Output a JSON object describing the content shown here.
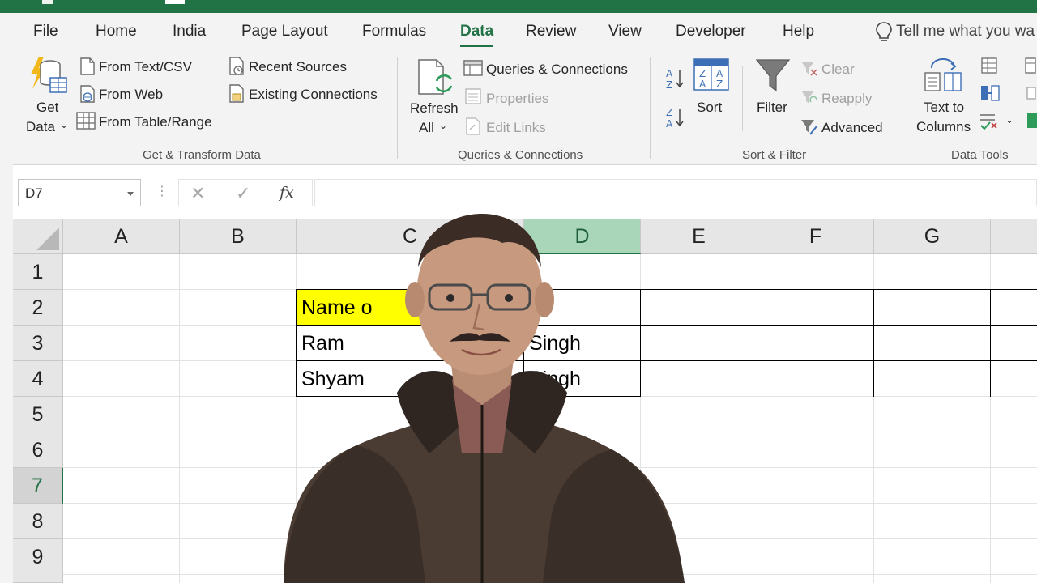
{
  "app": {
    "accent": "#217346"
  },
  "menu": {
    "tabs": [
      {
        "label": "File"
      },
      {
        "label": "Home"
      },
      {
        "label": "India"
      },
      {
        "label": "Page Layout"
      },
      {
        "label": "Formulas"
      },
      {
        "label": "Data",
        "active": true
      },
      {
        "label": "Review"
      },
      {
        "label": "View"
      },
      {
        "label": "Developer"
      },
      {
        "label": "Help"
      }
    ],
    "tell_me": "Tell me what you wa"
  },
  "ribbon": {
    "get_transform": {
      "get_data_line1": "Get",
      "get_data_line2": "Data",
      "from_text_csv": "From Text/CSV",
      "from_web": "From Web",
      "from_table_range": "From Table/Range",
      "recent_sources": "Recent Sources",
      "existing_connections": "Existing Connections",
      "label": "Get & Transform Data"
    },
    "queries": {
      "refresh_line1": "Refresh",
      "refresh_line2": "All",
      "queries_connections": "Queries & Connections",
      "properties": "Properties",
      "edit_links": "Edit Links",
      "label": "Queries & Connections"
    },
    "sort_filter": {
      "sort": "Sort",
      "filter": "Filter",
      "clear": "Clear",
      "reapply": "Reapply",
      "advanced": "Advanced",
      "label": "Sort & Filter"
    },
    "data_tools": {
      "text_to_columns_line1": "Text to",
      "text_to_columns_line2": "Columns",
      "label": "Data Tools"
    }
  },
  "formula_bar": {
    "name_box": "D7",
    "fx": "fx",
    "cancel": "✕",
    "enter": "✓",
    "content": ""
  },
  "sheet": {
    "columns": [
      "A",
      "B",
      "C",
      "D",
      "E",
      "F",
      "G"
    ],
    "rows": [
      "1",
      "2",
      "3",
      "4",
      "5",
      "6",
      "7",
      "8",
      "9"
    ],
    "selected_column": "D",
    "selected_row": "7",
    "cells": {
      "C2": "Name o",
      "C3": "Ram",
      "C4": "Shyam",
      "D3": "Singh",
      "D4": "Singh"
    }
  },
  "overlay": {
    "presenter": "webcam-presenter"
  }
}
